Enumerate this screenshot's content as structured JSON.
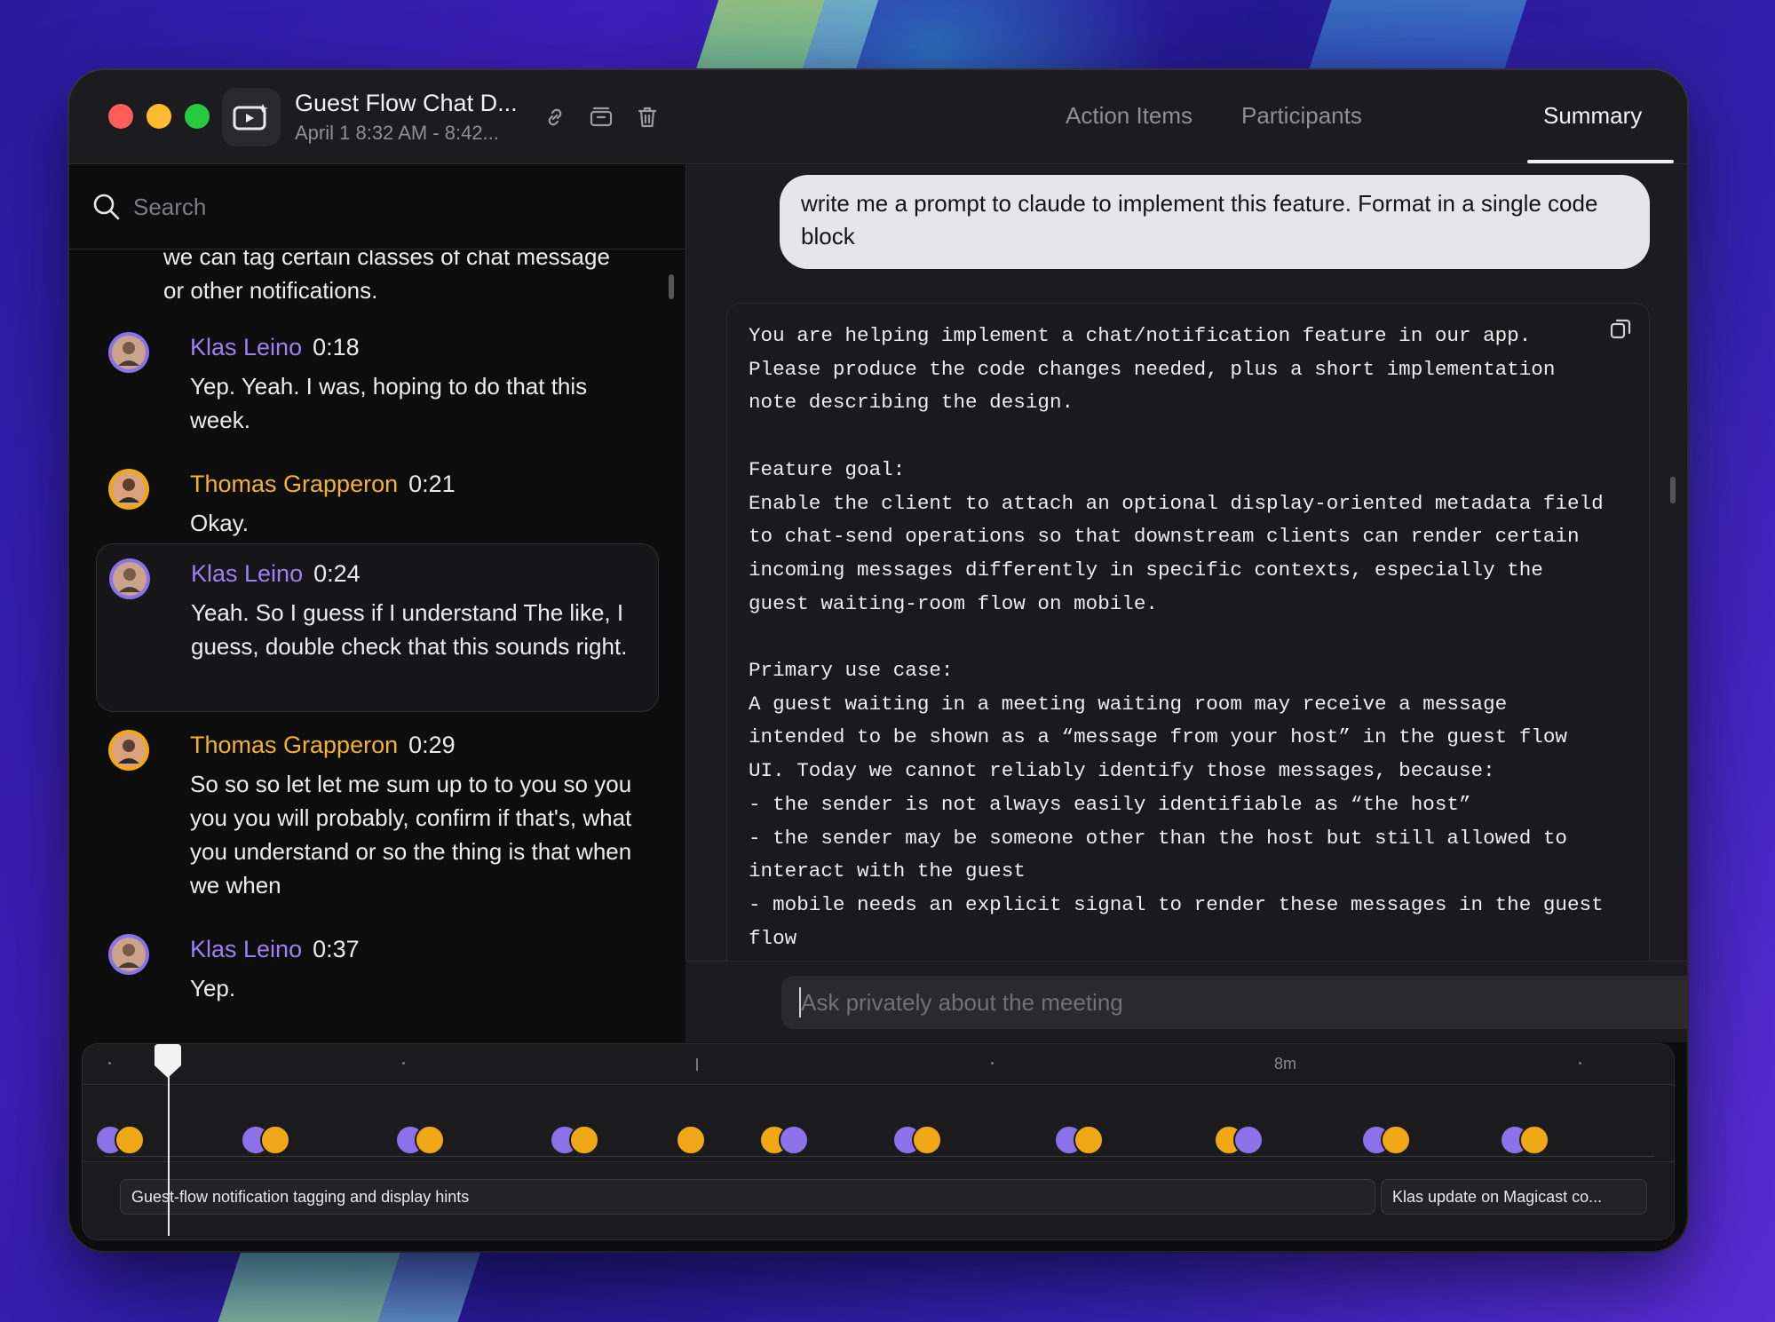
{
  "window": {
    "title": "Guest Flow Chat D...",
    "subtitle": "April 1 8:32 AM - 8:42..."
  },
  "search": {
    "placeholder": "Search"
  },
  "transcript": {
    "partial_text": "we can tag certain classes of chat message or other notifications.",
    "messages": [
      {
        "speaker": "Klas Leino",
        "time": "0:18",
        "text": "Yep. Yeah. I was, hoping to do that this week."
      },
      {
        "speaker": "Thomas Grapperon",
        "time": "0:21",
        "text": "Okay."
      },
      {
        "speaker": "Klas Leino",
        "time": "0:24",
        "text": "Yeah. So I guess if I understand The like, I guess, double check that this sounds right."
      },
      {
        "speaker": "Thomas Grapperon",
        "time": "0:29",
        "text": "So so so let let me sum up to to you so you you you will probably, confirm if that's, what you understand or so the thing is that when we when"
      },
      {
        "speaker": "Klas Leino",
        "time": "0:37",
        "text": "Yep."
      }
    ]
  },
  "tabs": [
    {
      "label": "Action Items"
    },
    {
      "label": "Participants"
    },
    {
      "label": "Summary"
    }
  ],
  "chat": {
    "user_message": "write me a prompt to claude to implement this feature. Format in a single code block",
    "code_block": "You are helping implement a chat/notification feature in our app.\nPlease produce the code changes needed, plus a short implementation\nnote describing the design.\n\nFeature goal:\nEnable the client to attach an optional display-oriented metadata field\nto chat-send operations so that downstream clients can render certain\nincoming messages differently in specific contexts, especially the\nguest waiting-room flow on mobile.\n\nPrimary use case:\nA guest waiting in a meeting waiting room may receive a message\nintended to be shown as a “message from your host” in the guest flow\nUI. Today we cannot reliably identify those messages, because:\n- the sender is not always easily identifiable as “the host”\n- the sender may be someone other than the host but still allowed to\ninteract with the guest\n- mobile needs an explicit signal to render these messages in the guest\nflow\n- what is allowed to"
  },
  "ask": {
    "placeholder": "Ask privately about the meeting"
  },
  "timeline": {
    "ruler_label": "8m",
    "segments": [
      {
        "label": "Guest-flow notification tagging and display hints"
      },
      {
        "label": "Klas update on Magicast co..."
      }
    ]
  },
  "colors": {
    "speaker_klas": "#9b82f2",
    "speaker_thomas": "#f5b22d",
    "traffic_red": "#fe5f57",
    "traffic_yellow": "#febc2e",
    "traffic_green": "#28c840"
  }
}
